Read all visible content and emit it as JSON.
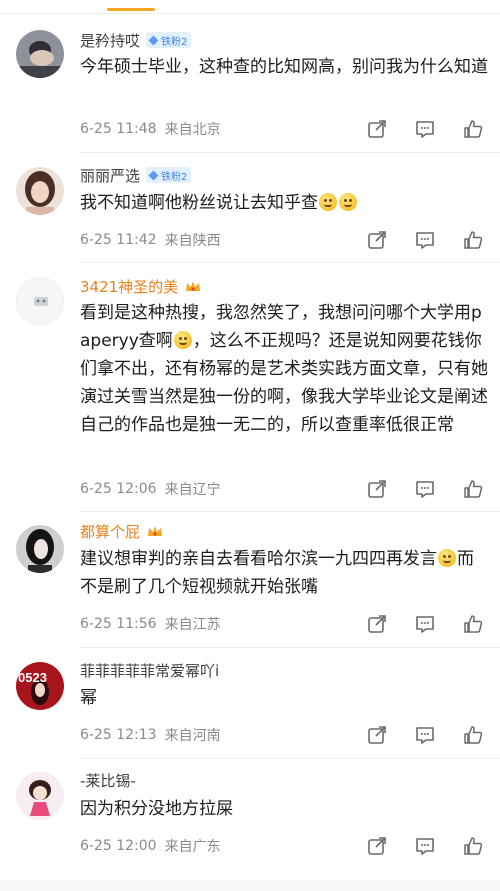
{
  "comments": [
    {
      "username": "是矜持哎",
      "name_style": "normal",
      "badge": {
        "type": "fan",
        "label": "铁粉2"
      },
      "content": "今年硕士毕业，这种查的比知网高，别问我为什么知道",
      "time": "6-25 11:48",
      "location": "来自北京",
      "avatar_color": "#6b6f7a"
    },
    {
      "username": "丽丽严选",
      "name_style": "normal",
      "badge": {
        "type": "fan",
        "label": "铁粉2"
      },
      "content": "我不知道啊他粉丝说让去知乎查",
      "emoji_count": 2,
      "time": "6-25 11:42",
      "location": "来自陕西",
      "avatar_color": "#caa48f"
    },
    {
      "username": "3421神圣的美",
      "name_style": "vip",
      "badge": {
        "type": "crown"
      },
      "content_parts": [
        "看到是这种热搜，我忽然笑了，我想问问哪个大学用paperyy查啊",
        "，这么不正规吗？还是说知网要花钱你们拿不出，还有杨幂的是艺术类实践方面文章，只有她演过关雪当然是独一份的啊，像我大学毕业论文是阐述自己的作品也是独一无二的，所以查重率低很正常"
      ],
      "time": "6-25 12:06",
      "location": "来自辽宁",
      "avatar_color": "#f3f3f3"
    },
    {
      "username": "都算个屁",
      "name_style": "vip",
      "badge": {
        "type": "crown"
      },
      "content_parts": [
        "建议想审判的亲自去看看哈尔滨一九四四再发言",
        "而不是刷了几个短视频就开始张嘴"
      ],
      "time": "6-25 11:56",
      "location": "来自江苏",
      "avatar_color": "#3a3a3a"
    },
    {
      "username": "菲菲菲菲菲常爱幂吖i",
      "name_style": "normal",
      "content": "幂",
      "time": "6-25 12:13",
      "location": "来自河南",
      "avatar_color": "#b3161d",
      "avatar_text": "0523"
    },
    {
      "username": "-莱比锡-",
      "name_style": "normal",
      "content": "因为积分没地方拉屎",
      "time": "6-25 12:00",
      "location": "来自广东",
      "avatar_color": "#f1e6e8"
    }
  ],
  "icons": {
    "share": "share-icon",
    "comment": "comment-icon",
    "like": "like-icon"
  },
  "colors": {
    "accent": "#f6a623",
    "vip_name": "#e8831f",
    "fan_badge_bg": "#e3f0ff",
    "fan_badge_text": "#3f87e6"
  }
}
